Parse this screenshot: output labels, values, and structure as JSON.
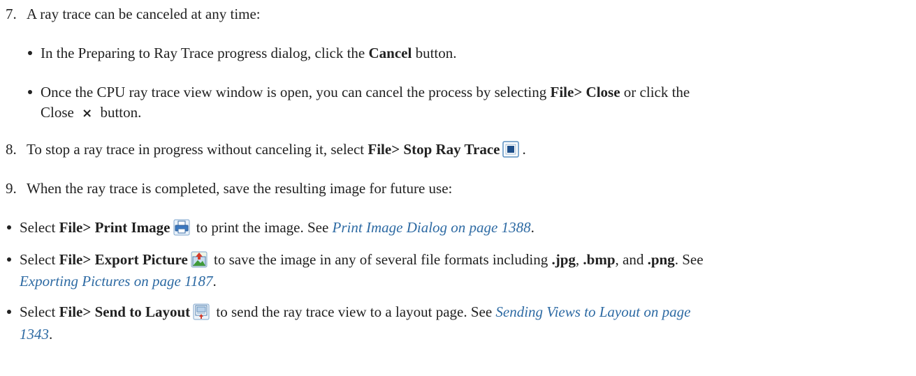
{
  "step7": {
    "num": "7.",
    "text": "A ray trace can be canceled at any time:",
    "bullet1": {
      "pre": "In the Preparing to Ray Trace progress dialog, click the ",
      "bold": "Cancel",
      "post": " button."
    },
    "bullet2": {
      "pre": "Once the CPU ray trace view window is open, you can cancel the process by selecting ",
      "bold": "File> Close",
      "mid": " or click the",
      "line2_pre": "Close ",
      "close_glyph": "×",
      "line2_post": " button."
    }
  },
  "step8": {
    "num": "8.",
    "pre": "To stop a ray trace in progress without canceling it, select ",
    "bold": "File> Stop Ray Trace",
    "post": ".",
    "icon": "stop-ray-trace-icon"
  },
  "step9": {
    "num": "9.",
    "text": "When the ray trace is completed, save the resulting image for future use:",
    "bullets": [
      {
        "pre": "Select ",
        "bold": "File> Print Image",
        "icon": "printer-icon",
        "post": " to print the image. See ",
        "link": "Print Image Dialog on page 1388",
        "end": "."
      },
      {
        "pre": "Select ",
        "bold": "File> Export Picture",
        "icon": "export-picture-icon",
        "post": " to save the image in any of several file formats including ",
        "fmt1": ".jpg",
        "sep1": ", ",
        "fmt2": ".bmp",
        "sep2": ", and ",
        "fmt3": ".png",
        "post2": ". See",
        "link": "Exporting Pictures on page 1187",
        "end": "."
      },
      {
        "pre": "Select ",
        "bold": "File> Send to Layout",
        "icon": "send-to-layout-icon",
        "post": " to send the ray trace view to a layout page. See ",
        "link_line1": "Sending Views to Layout on page",
        "link_line2": "1343",
        "end": "."
      }
    ]
  },
  "colors": {
    "text": "#222222",
    "link": "#2d6aa3"
  }
}
